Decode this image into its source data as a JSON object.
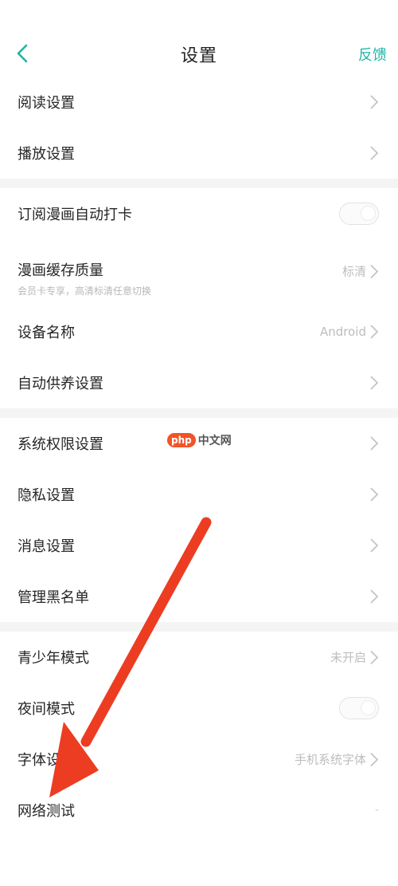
{
  "header": {
    "title": "设置",
    "feedback_label": "反馈",
    "back_icon": "chevron-left-icon",
    "accent_color": "#22b3a5"
  },
  "groups": [
    {
      "items": [
        {
          "label": "阅读设置",
          "control": "chevron"
        },
        {
          "label": "播放设置",
          "control": "chevron"
        }
      ]
    },
    {
      "items": [
        {
          "label": "订阅漫画自动打卡",
          "control": "toggle",
          "toggle_on": false
        },
        {
          "label": "漫画缓存质量",
          "sublabel": "会员卡专享，高清标清任意切换",
          "value": "标清",
          "control": "chevron"
        },
        {
          "label": "设备名称",
          "value": "Android",
          "control": "chevron"
        },
        {
          "label": "自动供养设置",
          "control": "chevron"
        }
      ]
    },
    {
      "items": [
        {
          "label": "系统权限设置",
          "control": "chevron"
        },
        {
          "label": "隐私设置",
          "control": "chevron"
        },
        {
          "label": "消息设置",
          "control": "chevron"
        },
        {
          "label": "管理黑名单",
          "control": "chevron"
        }
      ]
    },
    {
      "items": [
        {
          "label": "青少年模式",
          "value": "未开启",
          "control": "chevron"
        },
        {
          "label": "夜间模式",
          "control": "toggle",
          "toggle_on": false
        },
        {
          "label": "字体设置",
          "value": "手机系统字体",
          "control": "chevron"
        },
        {
          "label": "网络测试",
          "value": "-",
          "control": "none"
        }
      ]
    }
  ],
  "watermark": {
    "badge": "php",
    "text": "中文网",
    "color": "#f1542a"
  },
  "overlay": {
    "arrow_color": "#ec3d22",
    "arrow_target": "网络测试"
  }
}
